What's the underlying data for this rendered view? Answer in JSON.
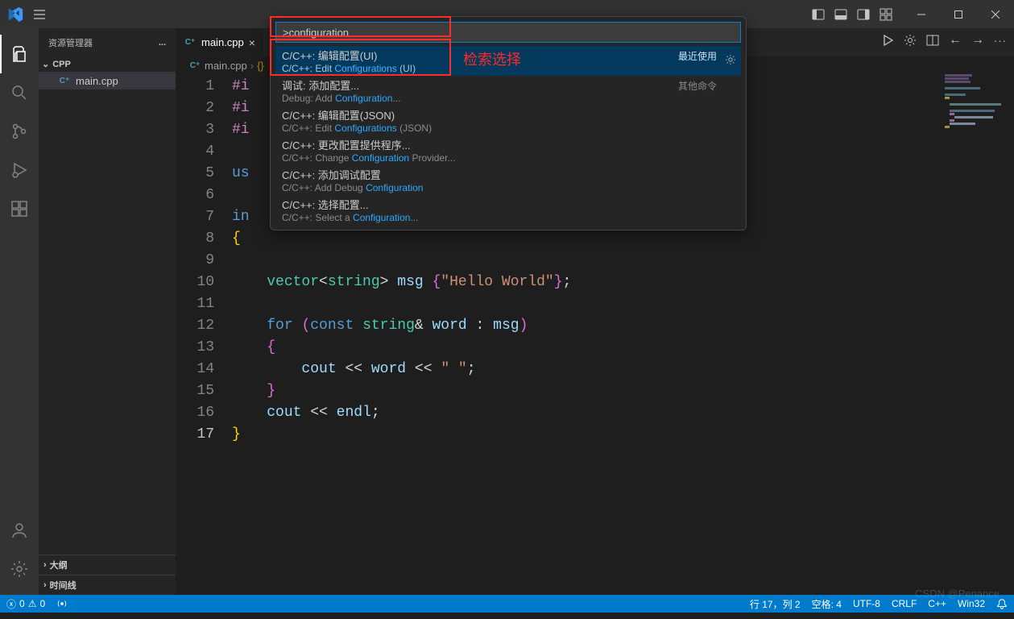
{
  "titlebar": {
    "layout_icons": [
      "panel-left",
      "panel-bottom",
      "panel-right",
      "layout-grid"
    ]
  },
  "activitybar": {
    "items": [
      "explorer",
      "search",
      "source-control",
      "run-debug",
      "extensions"
    ],
    "bottom": [
      "account",
      "settings"
    ]
  },
  "sidebar": {
    "title": "资源管理器",
    "more_label": "...",
    "sections": {
      "folder": {
        "name": "CPP",
        "expanded": true
      },
      "outline": "大纲",
      "timeline": "时间线"
    },
    "files": [
      {
        "name": "main.cpp",
        "icon": "C⁺",
        "selected": true
      }
    ]
  },
  "tabs": [
    {
      "label": "main.cpp",
      "icon": "C⁺",
      "active": true,
      "dirty": false
    }
  ],
  "breadcrumb": {
    "items": [
      "main.cpp"
    ],
    "trailing_icon": "{}"
  },
  "editor": {
    "visible_partial_lines": [
      {
        "n": 1,
        "text": "#i"
      },
      {
        "n": 2,
        "text": "#i"
      },
      {
        "n": 3,
        "text": "#i"
      },
      {
        "n": 4,
        "text": ""
      },
      {
        "n": 5,
        "text": "us"
      },
      {
        "n": 6,
        "text": ""
      },
      {
        "n": 7,
        "text": "in"
      }
    ],
    "lines": [
      {
        "n": 8,
        "tokens": [
          [
            "brace",
            "{"
          ]
        ]
      },
      {
        "n": 9,
        "tokens": []
      },
      {
        "n": 10,
        "tokens": [
          [
            "plain",
            "    "
          ],
          [
            "type",
            "vector"
          ],
          [
            "punc",
            "<"
          ],
          [
            "type",
            "string"
          ],
          [
            "punc",
            "> "
          ],
          [
            "var",
            "msg"
          ],
          [
            "plain",
            " "
          ],
          [
            "brace2",
            "{"
          ],
          [
            "str",
            "\"Hello World\""
          ],
          [
            "brace2",
            "}"
          ],
          [
            "punc",
            ";"
          ]
        ]
      },
      {
        "n": 11,
        "tokens": []
      },
      {
        "n": 12,
        "tokens": [
          [
            "plain",
            "    "
          ],
          [
            "kw",
            "for"
          ],
          [
            "plain",
            " "
          ],
          [
            "brace2",
            "("
          ],
          [
            "kw",
            "const"
          ],
          [
            "plain",
            " "
          ],
          [
            "type",
            "string"
          ],
          [
            "punc",
            "& "
          ],
          [
            "var",
            "word"
          ],
          [
            "plain",
            " "
          ],
          [
            "punc",
            ":"
          ],
          [
            "plain",
            " "
          ],
          [
            "var",
            "msg"
          ],
          [
            "brace2",
            ")"
          ]
        ]
      },
      {
        "n": 13,
        "tokens": [
          [
            "plain",
            "    "
          ],
          [
            "brace2",
            "{"
          ]
        ]
      },
      {
        "n": 14,
        "tokens": [
          [
            "plain",
            "        "
          ],
          [
            "var",
            "cout"
          ],
          [
            "plain",
            " "
          ],
          [
            "punc",
            "<<"
          ],
          [
            "plain",
            " "
          ],
          [
            "var",
            "word"
          ],
          [
            "plain",
            " "
          ],
          [
            "punc",
            "<<"
          ],
          [
            "plain",
            " "
          ],
          [
            "str",
            "\" \""
          ],
          [
            "punc",
            ";"
          ]
        ]
      },
      {
        "n": 15,
        "tokens": [
          [
            "plain",
            "    "
          ],
          [
            "brace2",
            "}"
          ]
        ]
      },
      {
        "n": 16,
        "tokens": [
          [
            "plain",
            "    "
          ],
          [
            "var",
            "cout"
          ],
          [
            "plain",
            " "
          ],
          [
            "punc",
            "<<"
          ],
          [
            "plain",
            " "
          ],
          [
            "var",
            "endl"
          ],
          [
            "punc",
            ";"
          ]
        ]
      },
      {
        "n": 17,
        "tokens": [
          [
            "brace",
            "}"
          ]
        ],
        "current": true
      }
    ]
  },
  "command_palette": {
    "input_value": ">configuration",
    "items": [
      {
        "title_prefix": "C/C++: ",
        "title": "编辑配置(UI)",
        "sub_prefix": "C/C++: Edit ",
        "sub_hl": "Configurations",
        "sub_suffix": " (UI)",
        "right": "最近使用",
        "gear": true,
        "selected": true
      },
      {
        "title_prefix": "调试: ",
        "title": "添加配置...",
        "sub_prefix": "Debug: Add ",
        "sub_hl": "Configuration",
        "sub_suffix": "...",
        "right": "其他命令"
      },
      {
        "title_prefix": "C/C++: ",
        "title": "编辑配置(JSON)",
        "sub_prefix": "C/C++: Edit ",
        "sub_hl": "Configurations",
        "sub_suffix": " (JSON)"
      },
      {
        "title_prefix": "C/C++: ",
        "title": "更改配置提供程序...",
        "sub_prefix": "C/C++: Change ",
        "sub_hl": "Configuration",
        "sub_suffix": " Provider..."
      },
      {
        "title_prefix": "C/C++: ",
        "title": "添加调试配置",
        "sub_prefix": "C/C++: Add Debug ",
        "sub_hl": "Configuration",
        "sub_suffix": ""
      },
      {
        "title_prefix": "C/C++: ",
        "title": "选择配置...",
        "sub_prefix": "C/C++: Select a ",
        "sub_hl": "Configuration",
        "sub_suffix": "..."
      }
    ]
  },
  "red_annotation": {
    "label": "检索选择"
  },
  "statusbar": {
    "errors": "0",
    "warnings": "0",
    "ln_col": "行 17，列 2",
    "spaces": "空格: 4",
    "encoding": "UTF-8",
    "eol": "CRLF",
    "lang": "C++",
    "config": "Win32",
    "bell": "bell-icon"
  },
  "watermark": "CSDN @Penance"
}
